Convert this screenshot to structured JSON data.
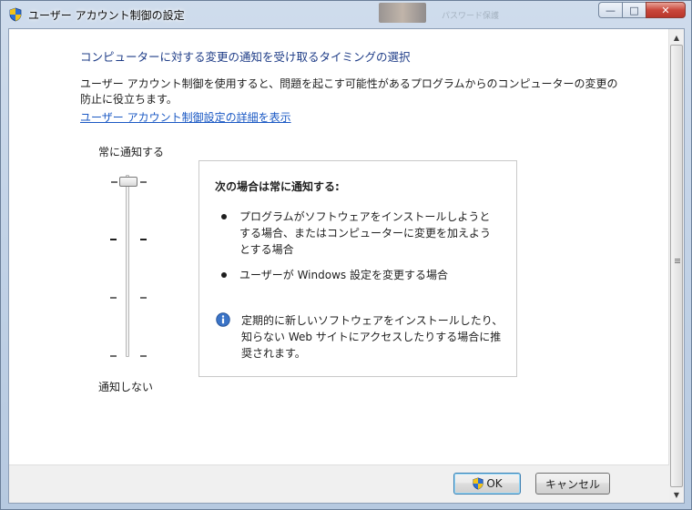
{
  "window": {
    "title": "ユーザー アカウント制御の設定",
    "background_window_text": "パスワード保護"
  },
  "content": {
    "heading": "コンピューターに対する変更の通知を受け取るタイミングの選択",
    "description": "ユーザー アカウント制御を使用すると、問題を起こす可能性があるプログラムからのコンピューターの変更の防止に役立ちます。",
    "link": "ユーザー アカウント制御設定の詳細を表示"
  },
  "slider": {
    "top_label": "常に通知する",
    "bottom_label": "通知しない",
    "levels": 4,
    "selected_level": 4
  },
  "panel": {
    "heading": "次の場合は常に通知する:",
    "bullets": [
      "プログラムがソフトウェアをインストールしようとする場合、またはコンピューターに変更を加えようとする場合",
      "ユーザーが Windows 設定を変更する場合"
    ],
    "note": "定期的に新しいソフトウェアをインストールしたり、知らない Web サイトにアクセスしたりする場合に推奨されます。"
  },
  "buttons": {
    "ok": "OK",
    "cancel": "キャンセル"
  },
  "icons": {
    "title": "uac-shield-icon",
    "info": "info-icon",
    "ok": "uac-shield-icon"
  },
  "colors": {
    "heading": "#1e3c87",
    "link": "#1b59c4"
  }
}
